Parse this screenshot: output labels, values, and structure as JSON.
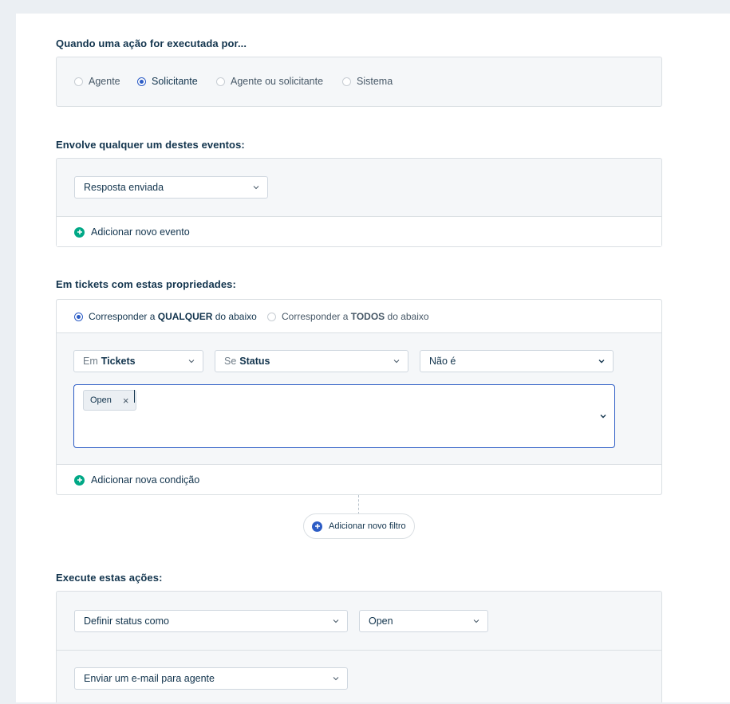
{
  "section1": {
    "title": "Quando uma ação for executada por...",
    "options": [
      {
        "label": "Agente",
        "selected": false
      },
      {
        "label": "Solicitante",
        "selected": true
      },
      {
        "label": "Agente ou solicitante",
        "selected": false
      },
      {
        "label": "Sistema",
        "selected": false
      }
    ]
  },
  "section2": {
    "title": "Envolve qualquer um destes eventos:",
    "event_value": "Resposta enviada",
    "add_label": "Adicionar novo evento"
  },
  "section3": {
    "title": "Em tickets com estas propriedades:",
    "match_any": {
      "prefix": "Corresponder a",
      "strong": "QUALQUER",
      "suffix": "do abaixo",
      "selected": true
    },
    "match_all": {
      "prefix": "Corresponder a",
      "strong": "TODOS",
      "suffix": "do abaixo",
      "selected": false
    },
    "condition": {
      "scope_prefix": "Em",
      "scope_value": "Tickets",
      "field_prefix": "Se",
      "field_value": "Status",
      "operator": "Não é",
      "tags": [
        "Open"
      ]
    },
    "add_condition_label": "Adicionar nova condição",
    "add_filter_label": "Adicionar novo filtro"
  },
  "section4": {
    "title": "Execute estas ações:",
    "action1": "Definir status como",
    "action1_value": "Open",
    "action2": "Enviar um e-mail para agente"
  },
  "colors": {
    "accent": "#2c5cc5",
    "add_green": "#00a886",
    "border": "#dadfe3",
    "panel": "#f5f7f9"
  },
  "icons": [
    "chevron-down-icon",
    "plus-circle-icon",
    "close-icon"
  ]
}
